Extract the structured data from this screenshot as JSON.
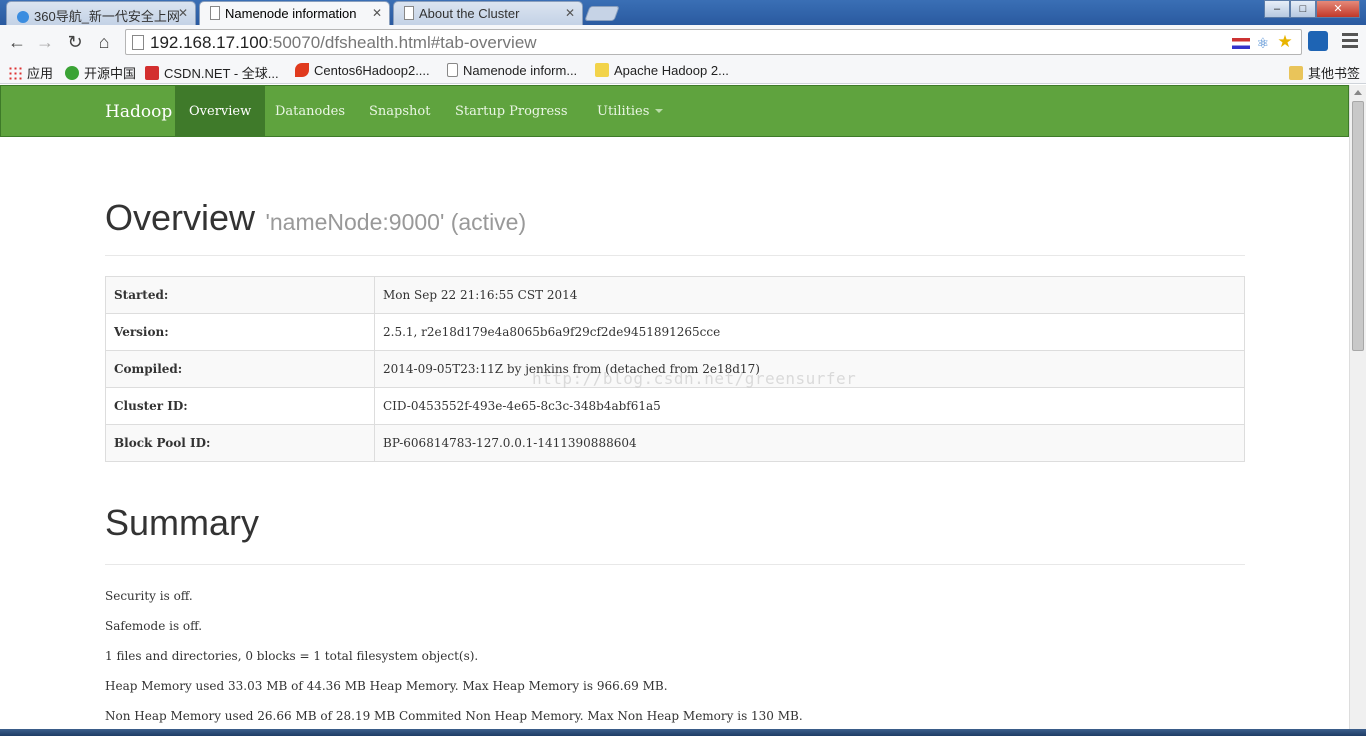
{
  "browser": {
    "tabs": [
      {
        "title": "360导航_新一代安全上网",
        "active": false
      },
      {
        "title": "Namenode information",
        "active": true
      },
      {
        "title": "About the Cluster",
        "active": false
      }
    ],
    "url": {
      "host": "192.168.17.100",
      "rest": ":50070/dfshealth.html#tab-overview"
    },
    "bookmarks": [
      "应用",
      "开源中国",
      "CSDN.NET - 全球...",
      "Centos6Hadoop2....",
      "Namenode inform...",
      "Apache Hadoop 2...",
      "其他书签"
    ],
    "window_buttons": {
      "minimize": "–",
      "maximize": "□",
      "close": "✕"
    }
  },
  "navbar": {
    "brand": "Hadoop",
    "items": [
      "Overview",
      "Datanodes",
      "Snapshot",
      "Startup Progress",
      "Utilities"
    ],
    "active": "Overview",
    "color": "#5fa33e"
  },
  "overview": {
    "title": "Overview",
    "subtitle": "'nameNode:9000' (active)",
    "rows": [
      {
        "key": "Started:",
        "value": "Mon Sep 22 21:16:55 CST 2014"
      },
      {
        "key": "Version:",
        "value": "2.5.1, r2e18d179e4a8065b6a9f29cf2de9451891265cce"
      },
      {
        "key": "Compiled:",
        "value": "2014-09-05T23:11Z by jenkins from (detached from 2e18d17)"
      },
      {
        "key": "Cluster ID:",
        "value": "CID-0453552f-493e-4e65-8c3c-348b4abf61a5"
      },
      {
        "key": "Block Pool ID:",
        "value": "BP-606814783-127.0.0.1-1411390888604"
      }
    ]
  },
  "watermark": "http://blog.csdn.net/greensurfer",
  "summary": {
    "title": "Summary",
    "lines": [
      "Security is off.",
      "Safemode is off.",
      "1 files and directories, 0 blocks = 1 total filesystem object(s).",
      "Heap Memory used 33.03 MB of 44.36 MB Heap Memory. Max Heap Memory is 966.69 MB.",
      "Non Heap Memory used 26.66 MB of 28.19 MB Commited Non Heap Memory. Max Non Heap Memory is 130 MB."
    ]
  }
}
